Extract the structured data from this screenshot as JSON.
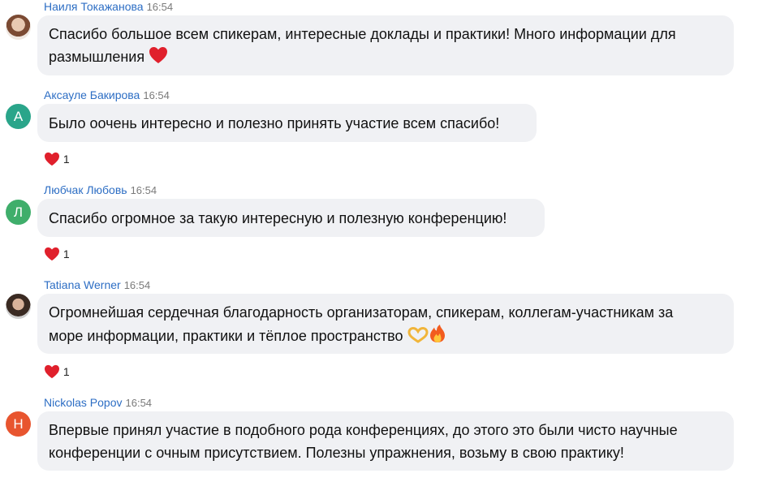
{
  "messages": [
    {
      "author": "Наиля Токажанова",
      "time": "16:54",
      "avatar": {
        "type": "photo"
      },
      "text_lines": [
        "Спасибо большое всем спикерам, интересные доклады и практики! Много информации для",
        "размышления"
      ],
      "trailing_emoji": [
        "red-heart"
      ],
      "reaction": null
    },
    {
      "author": "Аксауле Бакирова",
      "time": "16:54",
      "avatar": {
        "type": "letter",
        "letter": "А",
        "color": "#2aa58a"
      },
      "text_lines": [
        "Было оочень интересно и полезно принять участие всем спасибо!"
      ],
      "reaction": {
        "emoji": "red-heart",
        "count": "1"
      }
    },
    {
      "author": "Любчак Любовь",
      "time": "16:54",
      "avatar": {
        "type": "letter",
        "letter": "Л",
        "color": "#3fae6b"
      },
      "text_lines": [
        "Спасибо огромное за такую интересную и полезную конференцию!"
      ],
      "reaction": {
        "emoji": "red-heart",
        "count": "1"
      }
    },
    {
      "author": "Tatiana Werner",
      "time": "16:54",
      "avatar": {
        "type": "photo"
      },
      "text_lines": [
        "Огромнейшая сердечная благодарность организаторам, спикерам, коллегам-участникам за",
        "море информации,  практики и тёплое пространство"
      ],
      "trailing_emoji": [
        "heart-hands",
        "fire"
      ],
      "reaction": {
        "emoji": "red-heart",
        "count": "1"
      }
    },
    {
      "author": "Nickolas Popov",
      "time": "16:54",
      "avatar": {
        "type": "letter",
        "letter": "Н",
        "color": "#e8552f"
      },
      "text_lines": [
        "Впервые принял участие в подобного рода конференциях, до этого это были чисто научные",
        "конференции с очным присутствием. Полезны упражнения, возьму в свою практику!"
      ],
      "reaction": null
    }
  ],
  "colors": {
    "author_name": "#2d6ec4",
    "bubble_bg": "#f0f1f4",
    "heart": "#e0202c"
  }
}
